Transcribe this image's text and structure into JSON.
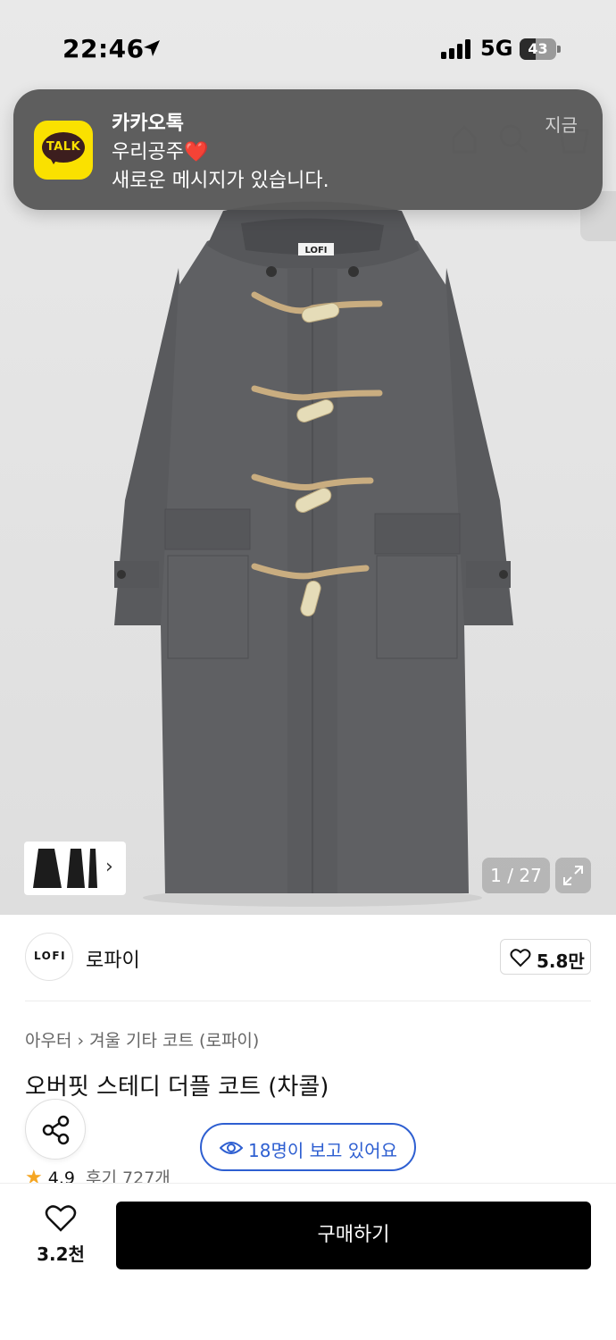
{
  "status_bar": {
    "time": "22:46",
    "network": "5G",
    "battery": "43",
    "battery_percent": 43
  },
  "notification": {
    "app_name": "카카오톡",
    "app_icon_text": "TALK",
    "time": "지금",
    "title": "우리공주",
    "title_emoji": "❤️",
    "body": "새로운 메시지가 있습니다."
  },
  "gallery": {
    "counter": "1 / 27",
    "thumb_chevron": "›",
    "coat_label": "LOFI"
  },
  "brand": {
    "logo_text": "LOFI",
    "name": "로파이",
    "likes": "5.8만"
  },
  "breadcrumb": {
    "items": [
      "아우터",
      "겨울 기타 코트 (로파이)"
    ],
    "separator": "›"
  },
  "product": {
    "title": "오버핏 스테디 더플 코트 (차콜)",
    "viewers": "18명이 보고 있어요",
    "rating": "4.9",
    "reviews": "후기 727개"
  },
  "bottom_bar": {
    "wish_count": "3.2천",
    "buy_label": "구매하기"
  },
  "colors": {
    "accent_blue": "#2e5fd1",
    "kakao_yellow": "#fae100",
    "star": "#f5a623",
    "buy_button": "#000000",
    "coat": "#5b5c5f"
  }
}
